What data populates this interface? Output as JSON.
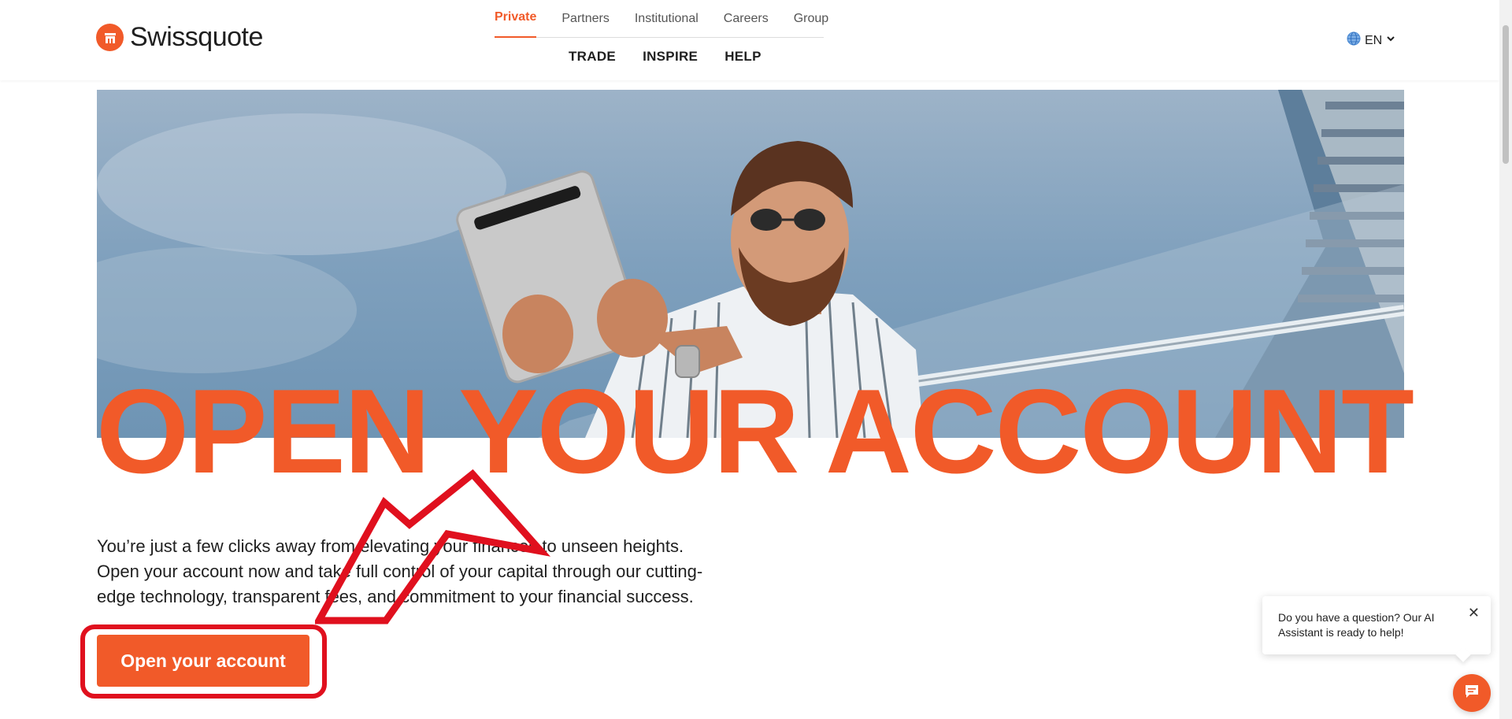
{
  "brand": {
    "name": "Swissquote",
    "accent": "#f15a29"
  },
  "top_tabs": [
    "Private",
    "Partners",
    "Institutional",
    "Careers",
    "Group"
  ],
  "active_tab": "Private",
  "main_nav": [
    "TRADE",
    "INSPIRE",
    "HELP"
  ],
  "language": {
    "code": "EN",
    "icon": "globe-icon"
  },
  "hero": {
    "title": "OPEN YOUR ACCOUNT",
    "intro": "You’re just a few clicks away from elevating your finances to unseen heights. Open your account now and take full control of your capital through our cutting-edge technology, transparent fees, and commitment to your financial success.",
    "cta_label": "Open your account"
  },
  "annotation": {
    "color": "#e0101e"
  },
  "chat": {
    "prompt": "Do you have a question? Our AI Assistant is ready to help!",
    "close_symbol": "✕",
    "fab_icon": "chat-icon"
  }
}
